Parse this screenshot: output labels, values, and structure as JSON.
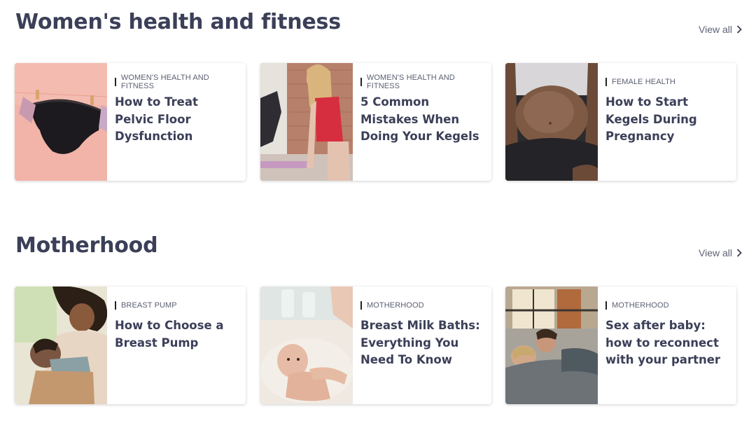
{
  "sections": [
    {
      "title": "Women's health and fitness",
      "view_all": "View all",
      "cards": [
        {
          "category": "WOMEN'S HEALTH AND FITNESS",
          "headline": "How to Treat Pelvic Floor Dysfunction",
          "image": "underwear-on-clothespin-image"
        },
        {
          "category": "WOMEN'S HEALTH AND FITNESS",
          "headline": "5 Common Mistakes When Doing Your Kegels",
          "image": "woman-exercising-image"
        },
        {
          "category": "FEMALE HEALTH",
          "headline": "How to Start Kegels During Pregnancy",
          "image": "pregnant-belly-image"
        }
      ]
    },
    {
      "title": "Motherhood",
      "view_all": "View all",
      "cards": [
        {
          "category": "BREAST PUMP",
          "headline": "How to Choose a Breast Pump",
          "image": "mother-breastfeeding-image"
        },
        {
          "category": "MOTHERHOOD",
          "headline": "Breast Milk Baths: Everything You Need To Know",
          "image": "baby-bath-image"
        },
        {
          "category": "MOTHERHOOD",
          "headline": "Sex after baby: how to reconnect with your partner",
          "image": "couple-in-bed-image"
        }
      ]
    }
  ]
}
